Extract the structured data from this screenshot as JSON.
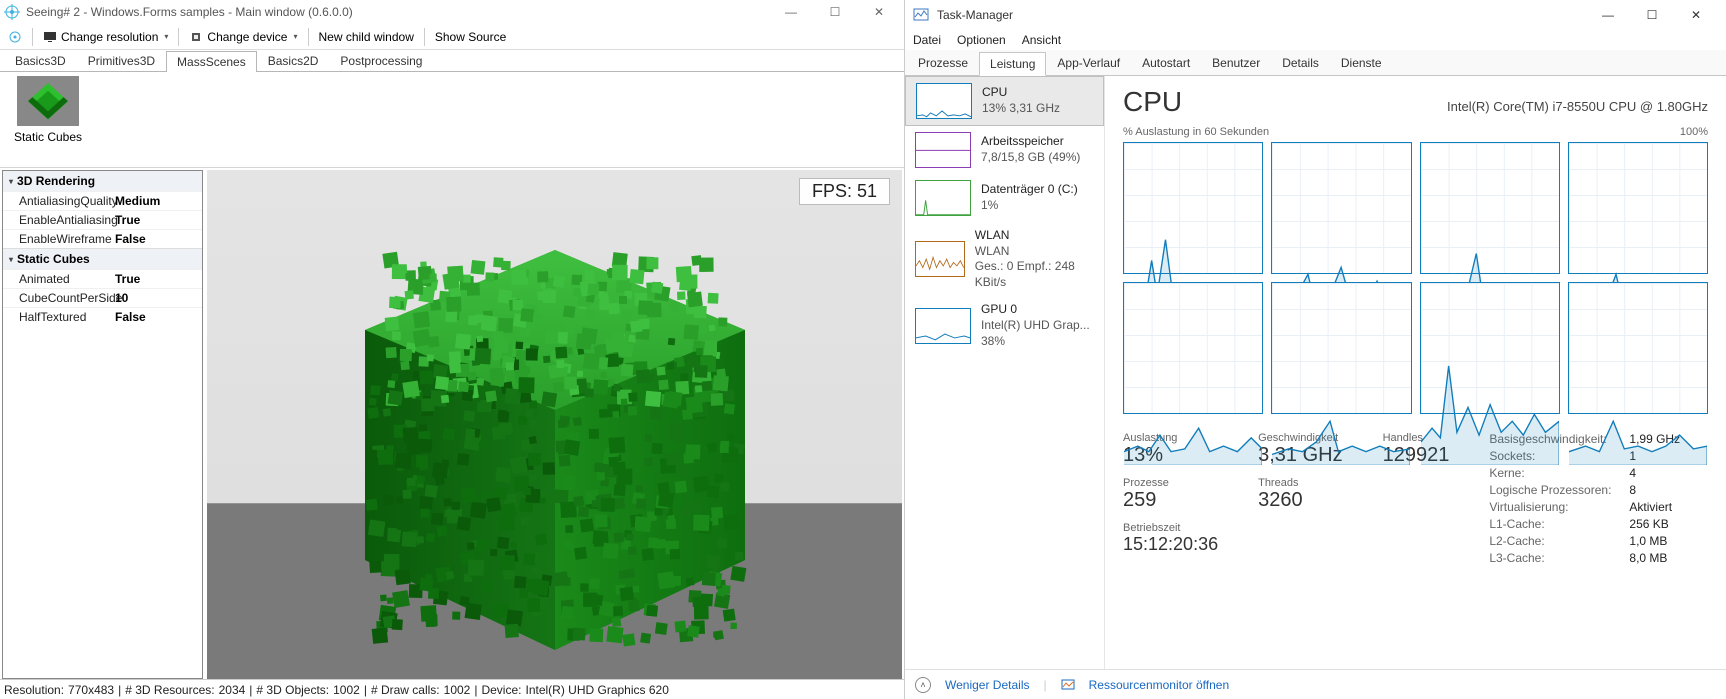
{
  "left": {
    "title": "Seeing# 2 - Windows.Forms samples - Main window (0.6.0.0)",
    "toolbar": {
      "change_resolution": "Change resolution",
      "change_device": "Change device",
      "new_child_window": "New child window",
      "show_source": "Show Source"
    },
    "tabs": [
      "Basics3D",
      "Primitives3D",
      "MassScenes",
      "Basics2D",
      "Postprocessing"
    ],
    "active_tab": "MassScenes",
    "thumb": {
      "label": "Static Cubes"
    },
    "propgrid": {
      "cat1": "3D Rendering",
      "rows1": [
        {
          "k": "AntialiasingQuality",
          "v": "Medium"
        },
        {
          "k": "EnableAntialiasing",
          "v": "True"
        },
        {
          "k": "EnableWireframe",
          "v": "False"
        }
      ],
      "cat2": "Static Cubes",
      "rows2": [
        {
          "k": "Animated",
          "v": "True"
        },
        {
          "k": "CubeCountPerSide",
          "v": "10"
        },
        {
          "k": "HalfTextured",
          "v": "False"
        }
      ]
    },
    "fps_label": "FPS: 51",
    "status": {
      "resolution_lbl": "Resolution:",
      "resolution_val": "770x483",
      "resources_lbl": "# 3D Resources:",
      "resources_val": "2034",
      "objects_lbl": "# 3D Objects:",
      "objects_val": "1002",
      "draw_lbl": "# Draw calls:",
      "draw_val": "1002",
      "device_lbl": "Device:",
      "device_val": "Intel(R) UHD Graphics 620"
    }
  },
  "right": {
    "title": "Task-Manager",
    "menu": [
      "Datei",
      "Optionen",
      "Ansicht"
    ],
    "tabs": [
      "Prozesse",
      "Leistung",
      "App-Verlauf",
      "Autostart",
      "Benutzer",
      "Details",
      "Dienste"
    ],
    "active_tab": "Leistung",
    "sidebar": [
      {
        "name": "CPU",
        "sub": "13%  3,31 GHz",
        "kind": "cpu"
      },
      {
        "name": "Arbeitsspeicher",
        "sub": "7,8/15,8 GB (49%)",
        "kind": "mem"
      },
      {
        "name": "Datenträger 0 (C:)",
        "sub": "1%",
        "kind": "disk"
      },
      {
        "name": "WLAN",
        "sub": "WLAN",
        "sub2": "Ges.: 0 Empf.: 248 KBit/s",
        "kind": "net"
      },
      {
        "name": "GPU 0",
        "sub": "Intel(R) UHD Grap...",
        "sub2": "38%",
        "kind": "gpu"
      }
    ],
    "header": {
      "title": "CPU",
      "subtitle": "Intel(R) Core(TM) i7-8550U CPU @ 1.80GHz"
    },
    "graph_caption_left": "% Auslastung in 60 Sekunden",
    "graph_caption_right": "100%",
    "stats": {
      "auslastung_lbl": "Auslastung",
      "auslastung_val": "13%",
      "speed_lbl": "Geschwindigkeit",
      "speed_val": "3,31 GHz",
      "prozesse_lbl": "Prozesse",
      "prozesse_val": "259",
      "threads_lbl": "Threads",
      "threads_val": "3260",
      "handles_lbl": "Handles",
      "handles_val": "129921",
      "uptime_lbl": "Betriebszeit",
      "uptime_val": "15:12:20:36",
      "details": [
        {
          "k": "Basisgeschwindigkeit:",
          "v": "1,99 GHz"
        },
        {
          "k": "Sockets:",
          "v": "1"
        },
        {
          "k": "Kerne:",
          "v": "4"
        },
        {
          "k": "Logische Prozessoren:",
          "v": "8"
        },
        {
          "k": "Virtualisierung:",
          "v": "Aktiviert"
        },
        {
          "k": "L1-Cache:",
          "v": "256 KB"
        },
        {
          "k": "L2-Cache:",
          "v": "1,0 MB"
        },
        {
          "k": "L3-Cache:",
          "v": "8,0 MB"
        }
      ]
    },
    "footer": {
      "less": "Weniger Details",
      "resmon": "Ressourcenmonitor öffnen"
    }
  }
}
